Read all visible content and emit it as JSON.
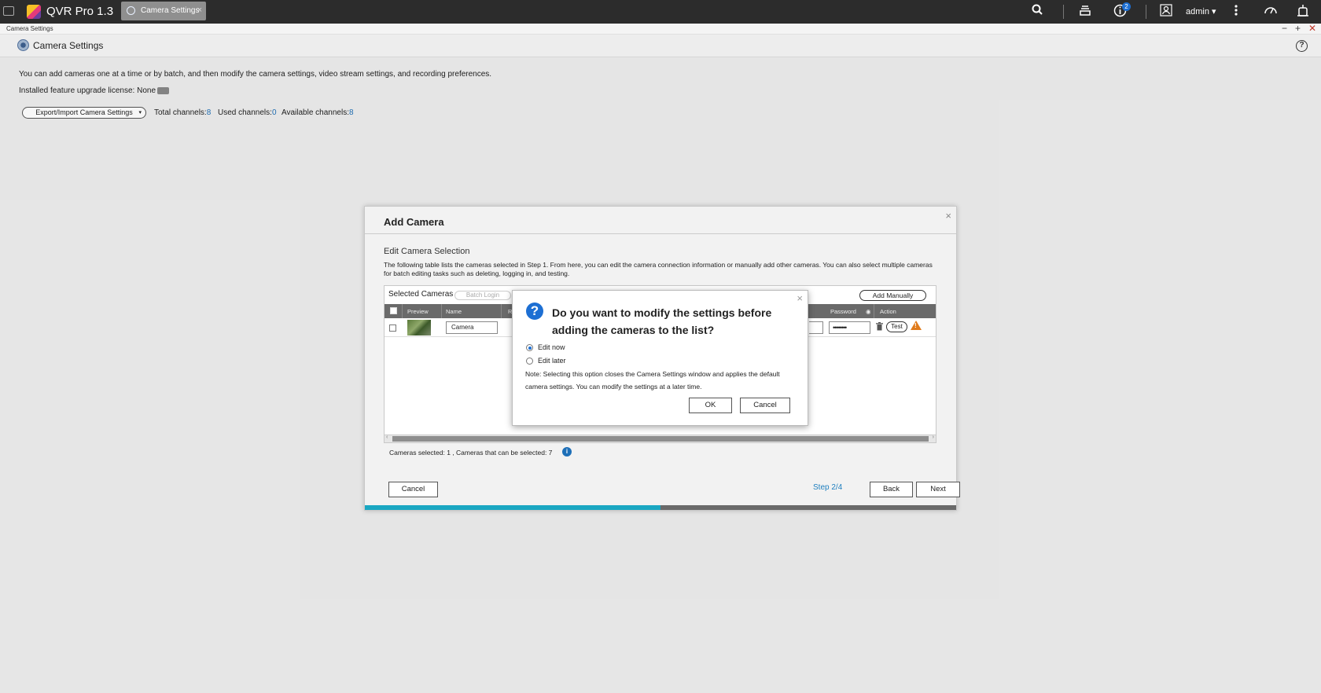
{
  "topbar": {
    "app_title": "QVR Pro 1.3",
    "tab_label": "Camera Settings",
    "tab_close": "×",
    "notification_count": "2",
    "user": "admin ▾"
  },
  "window": {
    "title": "Camera Settings",
    "controls": {
      "minimize": "−",
      "maximize": "+",
      "close": "✕"
    }
  },
  "header": {
    "title": "Camera Settings",
    "help": "?"
  },
  "main": {
    "intro": "You can add cameras one at a time or by batch, and then modify the camera settings, video stream settings, and recording preferences.",
    "license": "Installed feature upgrade license: None",
    "export_button": "Export/Import Camera Settings",
    "export_caret": "▾",
    "channels": {
      "total_label": "Total channels:",
      "total": "8",
      "used_label": "Used channels:",
      "used": "0",
      "available_label": "Available channels:",
      "available": "8"
    }
  },
  "add_camera": {
    "title": "Add Camera",
    "close": "×",
    "subtitle": "Edit Camera Selection",
    "description": "The following table lists the cameras selected in Step 1. From here, you can edit the camera connection information or manually add other cameras. You can also select multiple cameras for batch editing tasks such as deleting, logging in, and testing.",
    "panel_title": "Selected Cameras",
    "batch_login": "Batch Login",
    "add_manually": "Add Manually",
    "columns": {
      "preview": "Preview",
      "name": "Name",
      "partial": "R",
      "password": "Password",
      "action": "Action"
    },
    "row": {
      "name": "Camera",
      "password": "••••••••",
      "test": "Test"
    },
    "scroll_left": "‹",
    "scroll_right": "›",
    "selected_info": "Cameras selected:   1   , Cameras that can be selected:   7",
    "info": "i",
    "cancel": "Cancel",
    "step": "Step 2/4",
    "back": "Back",
    "next": "Next",
    "progress": 0.5
  },
  "confirm": {
    "close": "×",
    "question": "Do you want to modify the settings before adding the cameras to the list?",
    "option_now": "Edit now",
    "option_later": "Edit later",
    "note": "Note: Selecting this option closes the Camera Settings window and applies the default camera settings. You can modify the settings at a later time.",
    "ok": "OK",
    "cancel": "Cancel"
  },
  "colors": {
    "accent": "#1d6fd3",
    "progress": "#1aa7c2",
    "link": "#1f6fb5",
    "warning": "#e07a1a"
  }
}
